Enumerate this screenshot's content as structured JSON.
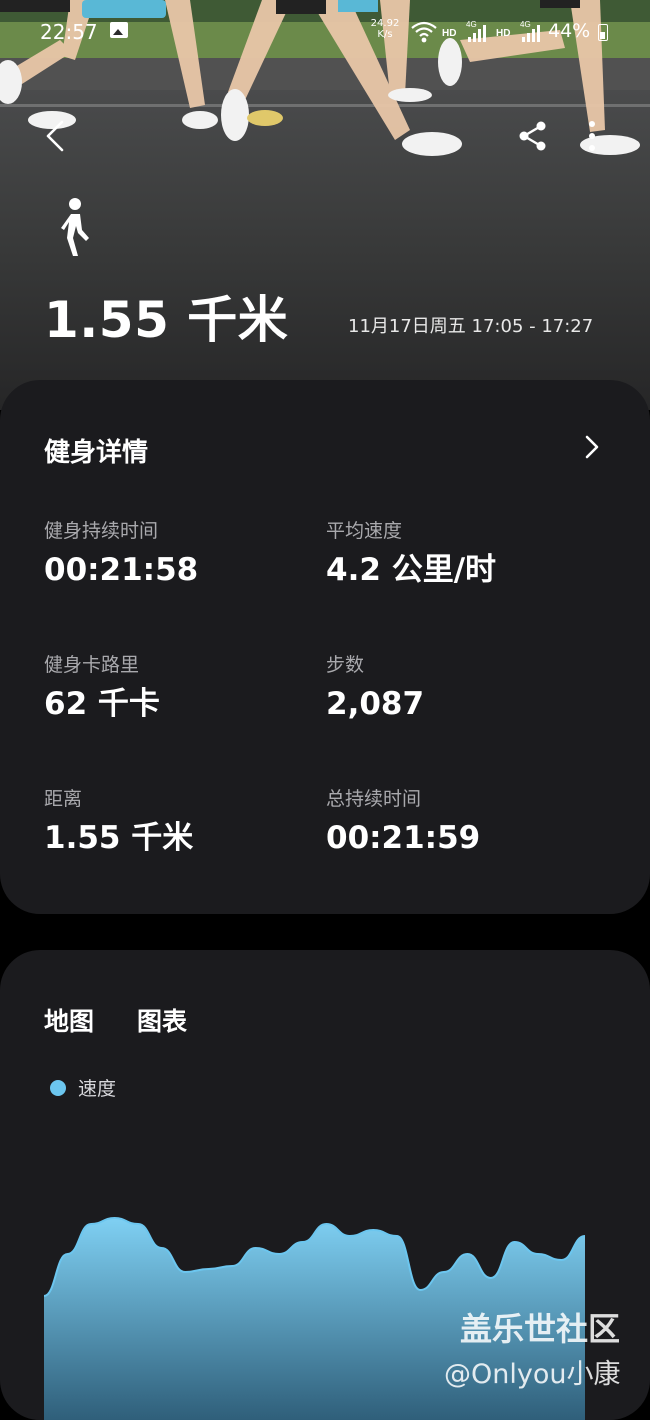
{
  "status_bar": {
    "time": "22:57",
    "net_speed_value": "24.92",
    "net_speed_unit": "K/s",
    "hd_label_1": "HD",
    "net_label_1": "4G",
    "hd_label_2": "HD",
    "net_label_2": "4G",
    "battery": "44%"
  },
  "hero": {
    "distance": "1.55 千米",
    "time_range": "11月17日周五 17:05 - 17:27"
  },
  "details": {
    "title": "健身详情",
    "stats": [
      {
        "label": "健身持续时间",
        "value": "00:21:58"
      },
      {
        "label": "平均速度",
        "value": "4.2 公里/时"
      },
      {
        "label": "健身卡路里",
        "value": "62 千卡"
      },
      {
        "label": "步数",
        "value": "2,087"
      },
      {
        "label": "距离",
        "value": "1.55 千米"
      },
      {
        "label": "总持续时间",
        "value": "00:21:59"
      }
    ]
  },
  "chart_section": {
    "tabs": [
      {
        "label": "地图"
      },
      {
        "label": "图表"
      }
    ],
    "legend_label": "速度",
    "colors": {
      "series": "#6cc6ef",
      "fill_top": "#7fd0f3",
      "fill_bottom": "#2f5f7a"
    }
  },
  "chart_data": {
    "type": "area",
    "title": "",
    "xlabel": "",
    "ylabel": "",
    "series": [
      {
        "name": "速度",
        "values": [
          3.4,
          4.1,
          4.6,
          4.7,
          4.6,
          4.2,
          3.8,
          3.85,
          3.9,
          4.2,
          4.1,
          4.3,
          4.6,
          4.4,
          4.5,
          4.4,
          3.5,
          3.8,
          4.1,
          3.7,
          4.3,
          4.1,
          4.0,
          4.4
        ]
      }
    ]
  },
  "watermark": {
    "title": "盖乐世社区",
    "user": "@Onlyou小康"
  }
}
